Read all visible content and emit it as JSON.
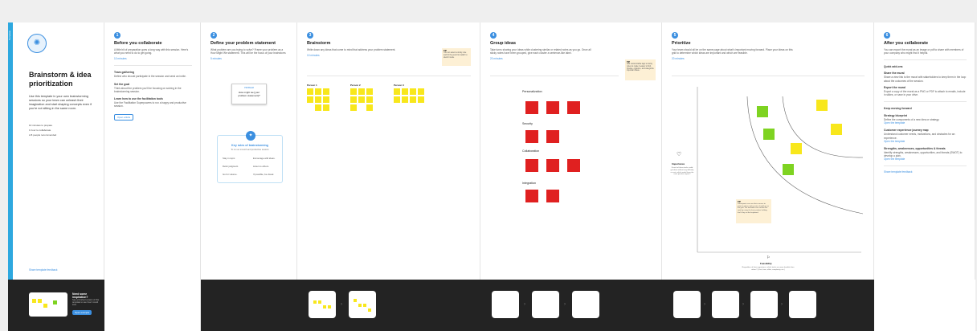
{
  "template_tab": "Template",
  "intro": {
    "title": "Brainstorm & idea prioritization",
    "desc": "Use this template in your own brainstorming sessions so your team can unleash their imagination and start shaping concepts even if you're not sitting in the same room.",
    "stats": [
      "10 minutes to prepare",
      "1 hour to collaborate",
      "2-8 people recommended"
    ],
    "feedback": "Share template feedback",
    "bottom_title": "Need some inspiration?",
    "bottom_desc": "See a finished version of this template to see how it could look.",
    "bottom_button": "Open example"
  },
  "before": {
    "num": "1",
    "title": "Before you collaborate",
    "desc": "A little bit of preparation goes a long way with this session. Here's what you need to do to get going.",
    "mins": "10 minutes",
    "steps": [
      {
        "n": "A",
        "title": "Team gathering",
        "desc": "Define who should participate in the session and send an invite."
      },
      {
        "n": "B",
        "title": "Set the goal",
        "desc": "Think about the problem you'll be focusing on solving in the brainstorming session."
      },
      {
        "n": "C",
        "title": "Learn how to use the facilitation tools",
        "desc": "Use the Facilitation Superpowers to run a happy and productive session."
      }
    ],
    "step_link": "Open article"
  },
  "define": {
    "num": "2",
    "title": "Define your problem statement",
    "desc": "What problem are you trying to solve? Frame your problem as a How Might We statement. This will be the focus of your brainstorm.",
    "mins": "5 minutes",
    "card_label": "PROBLEM",
    "card_text": "How might we [your problem statement]?",
    "rules_title": "Key rules of brainstorming",
    "rules_sub": "To run an smooth and productive session",
    "rules": [
      "Stay in topic.",
      "Encourage wild ideas.",
      "Defer judgment.",
      "Listen to others.",
      "Go for volume.",
      "If possible, be visual."
    ]
  },
  "brainstorm": {
    "num": "3",
    "title": "Brainstorm",
    "desc": "Write down any ideas that come to mind that address your problem statement.",
    "mins": "10 minutes",
    "tip_label": "TIP",
    "tip": "You can select a sticky note and hit the pencil to switch to sketch mode.",
    "people": [
      "Person 1",
      "Person 2",
      "Person 3"
    ]
  },
  "group": {
    "num": "4",
    "title": "Group ideas",
    "desc": "Take turns sharing your ideas while clustering similar or related notes as you go. Once all sticky notes have been grouped, give each cluster a sentence-like label.",
    "mins": "20 minutes",
    "tip_label": "TIP",
    "tip": "Add customizable tags to sticky notes to make it easier to find, browse, organize, and categorize important ideas.",
    "clusters": [
      "Personalization",
      "Security",
      "Collaboration",
      "Integration"
    ]
  },
  "prioritize": {
    "num": "5",
    "title": "Prioritize",
    "desc": "Your team should all be on the same page about what's important moving forward. Place your ideas on this grid to determine which ideas are important and which are feasible.",
    "mins": "20 minutes",
    "y_label": "Importance",
    "y_desc": "If each of these tasks could get done without any difficulty or cost, which would have the most positive impact?",
    "x_label": "Feasibility",
    "x_desc": "Regardless of their importance, which tasks are more feasible than others? (Cost, time, effort, complexity, etc.)",
    "tip_label": "TIP",
    "tip": "Participants can use their cursors to point at where sticky notes should go on the grid. The facilitator can confirm the spot by using the laser pointer holding the H key on the keyboard."
  },
  "after": {
    "num": "6",
    "title": "After you collaborate",
    "desc": "You can export the mural as an image or pdf to share with members of your company who might find it helpful.",
    "quick_title": "Quick add-ons",
    "quick": [
      {
        "n": "A",
        "title": "Share the mural",
        "desc": "Share a view link to the mural with stakeholders to keep them in the loop about the outcomes of the session."
      },
      {
        "n": "B",
        "title": "Export the mural",
        "desc": "Export a copy of the mural as a PNG or PDF to attach to emails, include in slides, or save in your drive."
      }
    ],
    "forward_title": "Keep moving forward",
    "forward": [
      {
        "title": "Strategy blueprint",
        "desc": "Define the components of a new idea or strategy.",
        "link": "Open the template"
      },
      {
        "title": "Customer experience journey map",
        "desc": "Understand customer needs, motivations, and obstacles for an experience.",
        "link": "Open the template"
      },
      {
        "title": "Strengths, weaknesses, opportunities & threats",
        "desc": "Identify strengths, weaknesses, opportunities, and threats (SWOT) to develop a plan.",
        "link": "Open the template"
      }
    ],
    "feedback": "Share template feedback"
  },
  "colors": {
    "accent": "#3b8fe0",
    "sidebar": "#2ea8df",
    "sticky_yellow": "#f8e71c",
    "sticky_green": "#7ed321",
    "sticky_red": "#e02020",
    "dark": "#2c2c2c"
  }
}
